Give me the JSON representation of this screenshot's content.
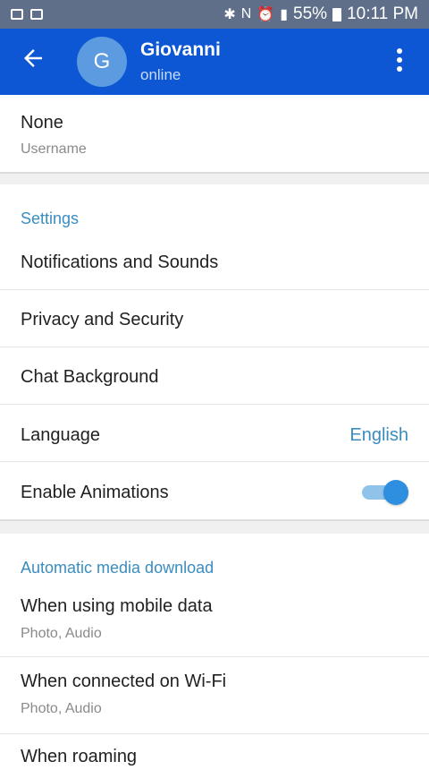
{
  "status_bar": {
    "battery": "55%",
    "time": "10:11 PM"
  },
  "appbar": {
    "avatar_letter": "G",
    "name": "Giovanni",
    "status": "online"
  },
  "account": {
    "username_value": "None",
    "username_label": "Username"
  },
  "settings": {
    "header": "Settings",
    "notifications": "Notifications and Sounds",
    "privacy": "Privacy and Security",
    "chat_background": "Chat Background",
    "language_label": "Language",
    "language_value": "English",
    "animations_label": "Enable Animations",
    "animations_enabled": true
  },
  "media": {
    "header": "Automatic media download",
    "mobile_label": "When using mobile data",
    "mobile_sub": "Photo, Audio",
    "wifi_label": "When connected on Wi-Fi",
    "wifi_sub": "Photo, Audio",
    "roaming_label": "When roaming"
  },
  "colors": {
    "appbar": "#0d57d4",
    "accent": "#3a8dc0",
    "toggle_on": "#2e8ee0"
  }
}
